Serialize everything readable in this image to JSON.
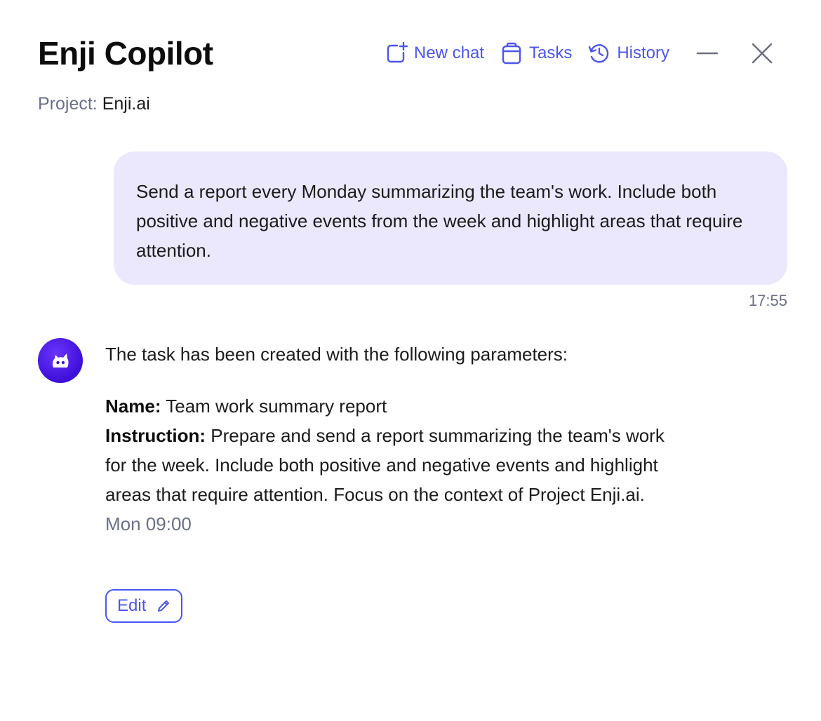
{
  "header": {
    "title": "Enji Copilot",
    "new_chat_label": "New chat",
    "tasks_label": "Tasks",
    "history_label": "History"
  },
  "project": {
    "label": "Project:",
    "value": "Enji.ai"
  },
  "messages": {
    "user": {
      "text": "Send a report every Monday summarizing the team's work. Include both positive and negative events from the week and highlight areas that require attention.",
      "time": "17:55"
    },
    "assistant": {
      "intro": "The task has been created with the following parameters:",
      "name_label": "Name:",
      "name_value": "Team work summary report",
      "instruction_label": "Instruction:",
      "instruction_value": "Prepare and send a report summarizing the team's work for the week. Include both positive and negative events and highlight areas that require attention. Focus on the context of Project Enji.ai.",
      "schedule": "Mon 09:00",
      "edit_label": "Edit"
    }
  },
  "colors": {
    "accent": "#4a56f0",
    "bubble_bg": "#ebe8fd",
    "muted_text": "#6b6f8a",
    "avatar": "#3d0fd8"
  },
  "icons": {
    "new_chat": "new-chat-icon",
    "tasks": "clipboard-icon",
    "history": "history-icon",
    "minimize": "minimize-icon",
    "close": "close-icon",
    "avatar": "enji-logo-icon",
    "edit": "pencil-icon"
  }
}
